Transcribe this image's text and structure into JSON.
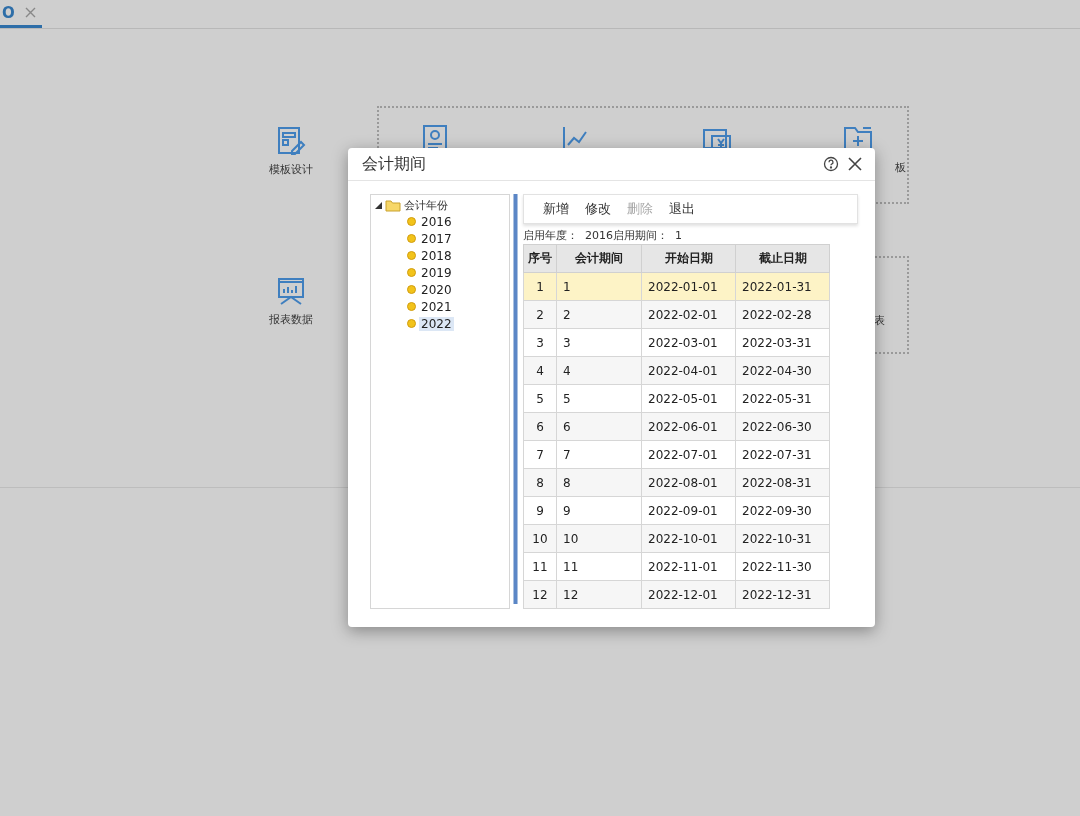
{
  "background": {
    "tab": {
      "label": "O",
      "selected": true
    },
    "launchers": [
      {
        "kind": "template-design",
        "label": "模板设计"
      },
      {
        "kind": "report-data",
        "label": "报表数据"
      },
      {
        "kind": "doc-chart"
      },
      {
        "kind": "trend-chart"
      },
      {
        "kind": "money-card"
      },
      {
        "kind": "add-folder",
        "label": "板"
      }
    ],
    "side_labels": [
      {
        "label": "表"
      }
    ]
  },
  "dialog": {
    "title": "会计期间",
    "tree": {
      "label": "会计年份",
      "expanded": true,
      "children": [
        {
          "label": "2016",
          "selected": false
        },
        {
          "label": "2017",
          "selected": false
        },
        {
          "label": "2018",
          "selected": false
        },
        {
          "label": "2019",
          "selected": false
        },
        {
          "label": "2020",
          "selected": false
        },
        {
          "label": "2021",
          "selected": false
        },
        {
          "label": "2022",
          "selected": true
        }
      ]
    },
    "toolbar": [
      {
        "label": "新增",
        "disabled": false
      },
      {
        "label": "修改",
        "disabled": false
      },
      {
        "label": "删除",
        "disabled": true
      },
      {
        "label": "退出",
        "disabled": false
      }
    ],
    "info": "启用年度：  2016启用期间：  1",
    "table": {
      "columns": [
        "序号",
        "会计期间",
        "开始日期",
        "截止日期"
      ],
      "rows": [
        {
          "cells": [
            "1",
            "1",
            "2022-01-01",
            "2022-01-31"
          ],
          "selected": true
        },
        {
          "cells": [
            "2",
            "2",
            "2022-02-01",
            "2022-02-28"
          ],
          "selected": false
        },
        {
          "cells": [
            "3",
            "3",
            "2022-03-01",
            "2022-03-31"
          ],
          "selected": false
        },
        {
          "cells": [
            "4",
            "4",
            "2022-04-01",
            "2022-04-30"
          ],
          "selected": false
        },
        {
          "cells": [
            "5",
            "5",
            "2022-05-01",
            "2022-05-31"
          ],
          "selected": false
        },
        {
          "cells": [
            "6",
            "6",
            "2022-06-01",
            "2022-06-30"
          ],
          "selected": false
        },
        {
          "cells": [
            "7",
            "7",
            "2022-07-01",
            "2022-07-31"
          ],
          "selected": false
        },
        {
          "cells": [
            "8",
            "8",
            "2022-08-01",
            "2022-08-31"
          ],
          "selected": false
        },
        {
          "cells": [
            "9",
            "9",
            "2022-09-01",
            "2022-09-30"
          ],
          "selected": false
        },
        {
          "cells": [
            "10",
            "10",
            "2022-10-01",
            "2022-10-31"
          ],
          "selected": false
        },
        {
          "cells": [
            "11",
            "11",
            "2022-11-01",
            "2022-11-30"
          ],
          "selected": false
        },
        {
          "cells": [
            "12",
            "12",
            "2022-12-01",
            "2022-12-31"
          ],
          "selected": false
        }
      ]
    }
  }
}
